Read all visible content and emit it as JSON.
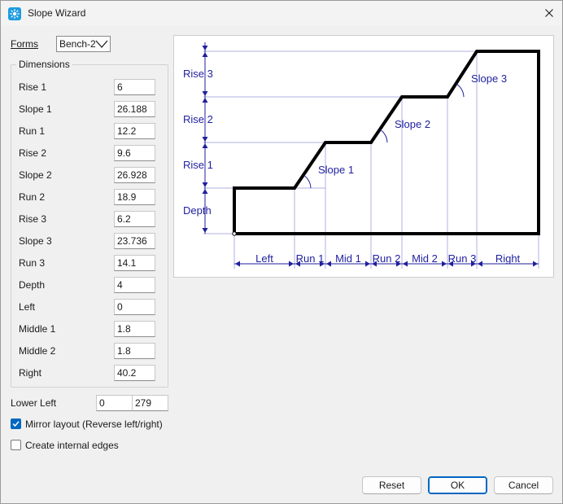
{
  "window": {
    "title": "Slope Wizard"
  },
  "forms": {
    "label": "Forms",
    "selected": "Bench-2"
  },
  "dimensions": {
    "group_title": "Dimensions",
    "fields": [
      {
        "label": "Rise 1",
        "value": "6"
      },
      {
        "label": "Slope 1",
        "value": "26.188"
      },
      {
        "label": "Run 1",
        "value": "12.2"
      },
      {
        "label": "Rise 2",
        "value": "9.6"
      },
      {
        "label": "Slope 2",
        "value": "26.928"
      },
      {
        "label": "Run 2",
        "value": "18.9"
      },
      {
        "label": "Rise 3",
        "value": "6.2"
      },
      {
        "label": "Slope 3",
        "value": "23.736"
      },
      {
        "label": "Run 3",
        "value": "14.1"
      },
      {
        "label": "Depth",
        "value": "4"
      },
      {
        "label": "Left",
        "value": "0"
      },
      {
        "label": "Middle 1",
        "value": "1.8"
      },
      {
        "label": "Middle 2",
        "value": "1.8"
      },
      {
        "label": "Right",
        "value": "40.2"
      }
    ]
  },
  "lower_left": {
    "label": "Lower Left",
    "x": "0",
    "y": "279"
  },
  "options": {
    "mirror_label": "Mirror layout (Reverse left/right)",
    "mirror_checked": true,
    "internal_edges_label": "Create internal edges",
    "internal_edges_checked": false
  },
  "diagram": {
    "vertical_labels": [
      "Rise 3",
      "Rise 2",
      "Rise 1",
      "Depth"
    ],
    "slope_labels": [
      "Slope 1",
      "Slope 2",
      "Slope 3"
    ],
    "horizontal_labels": [
      "Left",
      "Run 1",
      "Mid 1",
      "Run 2",
      "Mid 2",
      "Run 3",
      "Right"
    ]
  },
  "buttons": {
    "reset": "Reset",
    "ok": "OK",
    "cancel": "Cancel"
  },
  "colors": {
    "accent": "#0067c0",
    "dimension_text": "#1f1f9e",
    "guide_line": "#b0b0e0"
  }
}
